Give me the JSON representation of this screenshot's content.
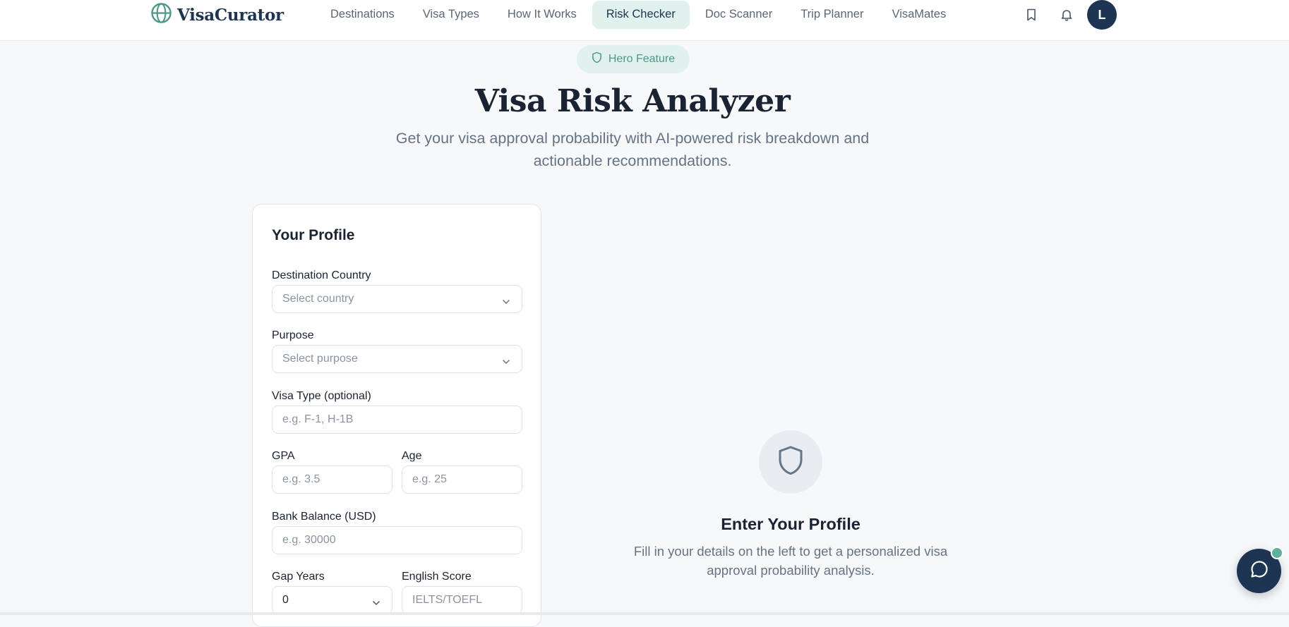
{
  "header": {
    "brand": "VisaCurator",
    "nav": [
      {
        "label": "Destinations",
        "active": false
      },
      {
        "label": "Visa Types",
        "active": false
      },
      {
        "label": "How It Works",
        "active": false
      },
      {
        "label": "Risk Checker",
        "active": true
      },
      {
        "label": "Doc Scanner",
        "active": false
      },
      {
        "label": "Trip Planner",
        "active": false
      },
      {
        "label": "VisaMates",
        "active": false
      }
    ],
    "icons": [
      "bookmark-icon",
      "bell-icon"
    ],
    "avatar_initial": "L"
  },
  "hero": {
    "badge": "Hero Feature",
    "title": "Visa Risk Analyzer",
    "subtitle": "Get your visa approval probability with AI-powered risk breakdown and actionable recommendations."
  },
  "profile": {
    "title": "Your Profile",
    "destination": {
      "label": "Destination Country",
      "placeholder": "Select country"
    },
    "purpose": {
      "label": "Purpose",
      "placeholder": "Select purpose"
    },
    "visa_type": {
      "label": "Visa Type (optional)",
      "placeholder": "e.g. F-1, H-1B"
    },
    "gpa": {
      "label": "GPA",
      "placeholder": "e.g. 3.5"
    },
    "age": {
      "label": "Age",
      "placeholder": "e.g. 25"
    },
    "bank_balance": {
      "label": "Bank Balance (USD)",
      "placeholder": "e.g. 30000"
    },
    "gap_years": {
      "label": "Gap Years",
      "value": "0"
    },
    "english_score": {
      "label": "English Score",
      "placeholder": "IELTS/TOEFL"
    }
  },
  "empty_state": {
    "title": "Enter Your Profile",
    "text": "Fill in your details on the left to get a personalized visa approval probability analysis."
  },
  "colors": {
    "brand_navy": "#1d3553",
    "accent_teal": "#4a9a86",
    "accent_bg": "#e1f2ee",
    "page_bg": "#f6f8f9"
  }
}
